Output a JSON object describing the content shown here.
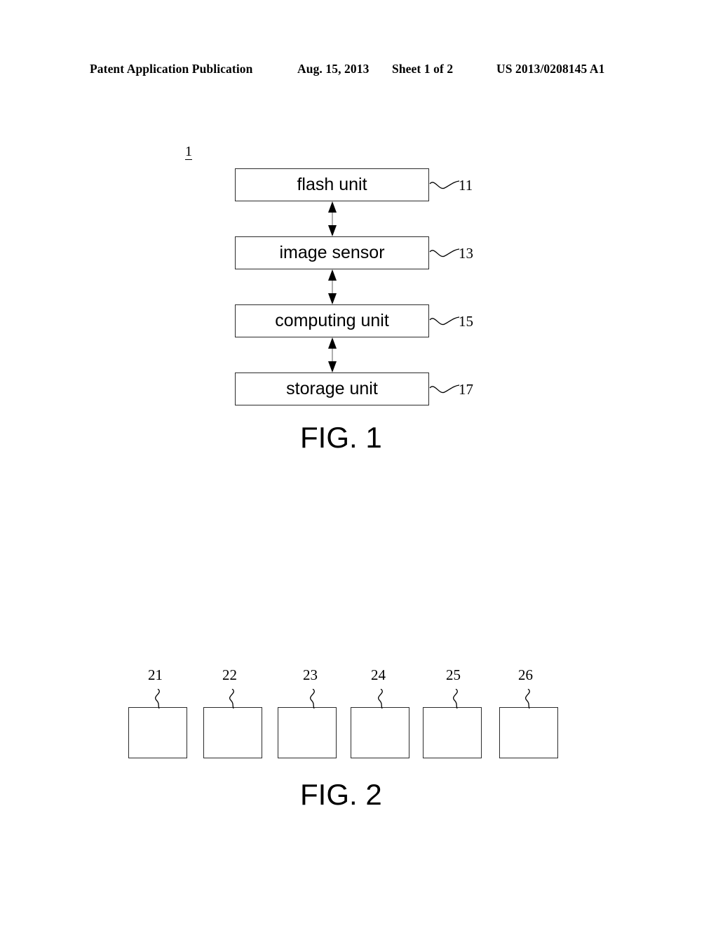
{
  "header": {
    "publication": "Patent Application Publication",
    "date": "Aug. 15, 2013",
    "sheet": "Sheet 1 of 2",
    "patent_number": "US 2013/0208145 A1"
  },
  "figure1": {
    "caption": "FIG. 1",
    "system_ref": "1",
    "blocks": [
      {
        "label": "flash unit",
        "ref": "11"
      },
      {
        "label": "image sensor",
        "ref": "13"
      },
      {
        "label": "computing unit",
        "ref": "15"
      },
      {
        "label": "storage unit",
        "ref": "17"
      }
    ],
    "connectors": [
      {
        "type": "double-headed-arrow",
        "from": "flash unit",
        "to": "image sensor"
      },
      {
        "type": "double-headed-arrow",
        "from": "image sensor",
        "to": "computing unit"
      },
      {
        "type": "double-headed-arrow",
        "from": "computing unit",
        "to": "storage unit"
      }
    ]
  },
  "figure2": {
    "caption": "FIG. 2",
    "blocks": [
      {
        "ref": "21",
        "label": ""
      },
      {
        "ref": "22",
        "label": ""
      },
      {
        "ref": "23",
        "label": ""
      },
      {
        "ref": "24",
        "label": ""
      },
      {
        "ref": "25",
        "label": ""
      },
      {
        "ref": "26",
        "label": ""
      }
    ]
  },
  "colors": {
    "ink": "#000000",
    "line": "#2b2b2b",
    "page": "#ffffff"
  }
}
